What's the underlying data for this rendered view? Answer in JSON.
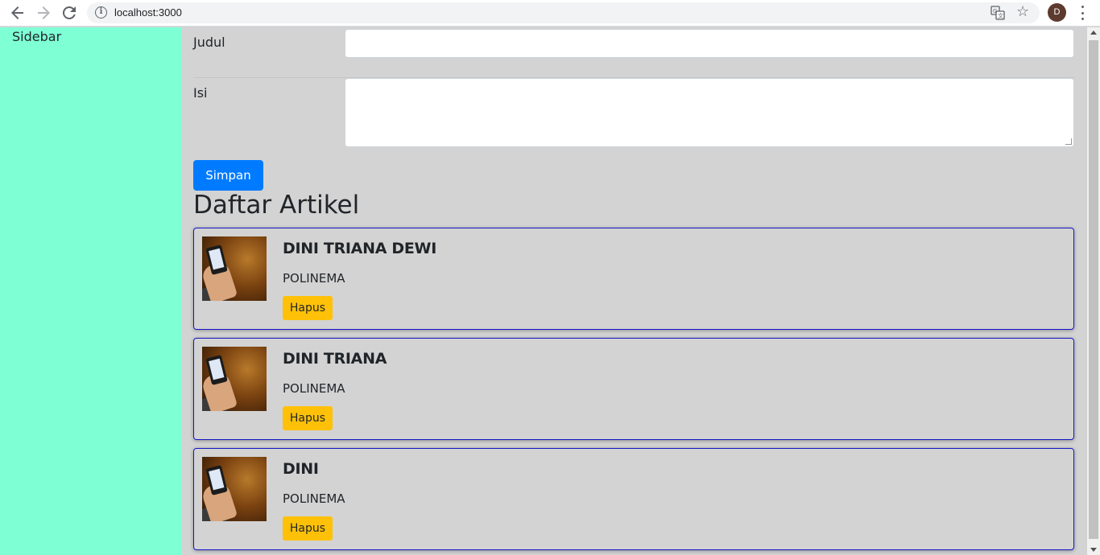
{
  "browser": {
    "url": "localhost:3000",
    "avatar_letter": "D",
    "icons": [
      "back-arrow-icon",
      "forward-arrow-icon",
      "reload-icon",
      "info-icon",
      "translate-icon",
      "star-icon",
      "menu-icon"
    ]
  },
  "sidebar": {
    "title": "Sidebar",
    "color": "#7fffd4"
  },
  "form": {
    "title_label": "Judul",
    "title_value": "",
    "content_label": "Isi",
    "content_value": "",
    "save_label": "Simpan"
  },
  "articles": {
    "heading": "Daftar Artikel",
    "items": [
      {
        "title": "DINI TRIANA DEWI",
        "subtitle": "POLINEMA",
        "delete_label": "Hapus"
      },
      {
        "title": "DINI TRIANA",
        "subtitle": "POLINEMA",
        "delete_label": "Hapus"
      },
      {
        "title": "DINI",
        "subtitle": "POLINEMA",
        "delete_label": "Hapus"
      }
    ]
  },
  "colors": {
    "primary": "#007bff",
    "warning": "#ffc107",
    "card_border": "#1515c8",
    "background": "#d3d3d3"
  }
}
